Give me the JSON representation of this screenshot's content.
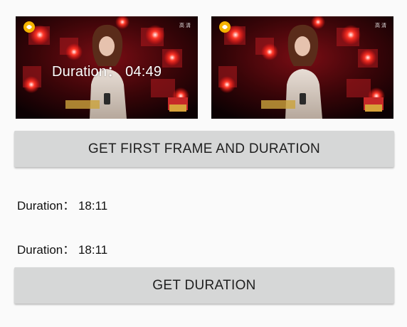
{
  "frames": {
    "left": {
      "overlay": "Duration： 04:49",
      "hd_badge": "高 清"
    },
    "right": {
      "hd_badge": "高 清"
    }
  },
  "buttons": {
    "first_frame_label": "GET FIRST FRAME AND DURATION",
    "duration_label": "GET DURATION"
  },
  "results": {
    "duration_1": "Duration： 18:11",
    "duration_2": "Duration： 18:11"
  },
  "colors": {
    "background": "#fafafa",
    "button": "#d6d7d7",
    "text": "#111111",
    "stage_red": "#e0141e"
  },
  "icons": {
    "channel_logo": "channel-logo-icon"
  }
}
